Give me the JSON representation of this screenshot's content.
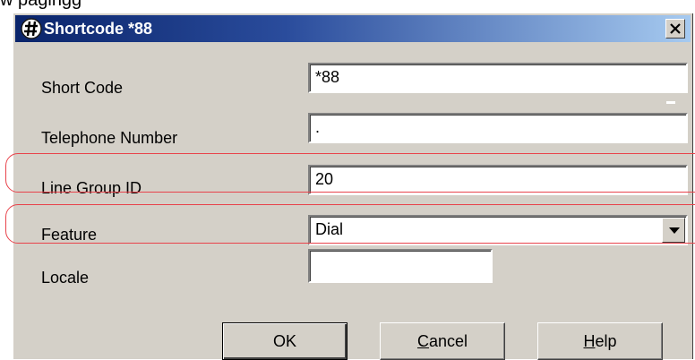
{
  "page_fragment": {
    "text": "w pagingg"
  },
  "dialog": {
    "title": "Shortcode *88",
    "title_icon": "hash-icon",
    "close_icon": "close-icon",
    "colors": {
      "title_start": "#0a246a",
      "title_end": "#a6caf0",
      "face": "#d4d0c8",
      "highlight": "#e8434b"
    }
  },
  "fields": {
    "short_code": {
      "label": "Short Code",
      "value": "*88"
    },
    "telephone_number": {
      "label": "Telephone Number",
      "value": "."
    },
    "line_group_id": {
      "label": "Line Group ID",
      "value": "20"
    },
    "feature": {
      "label": "Feature",
      "value": "Dial",
      "icon": "dropdown-arrow-icon"
    },
    "locale": {
      "label": "Locale",
      "value": ""
    }
  },
  "buttons": {
    "ok": "OK",
    "cancel": {
      "mnemonic": "C",
      "rest": "ancel"
    },
    "help": {
      "mnemonic": "H",
      "rest": "elp"
    }
  }
}
